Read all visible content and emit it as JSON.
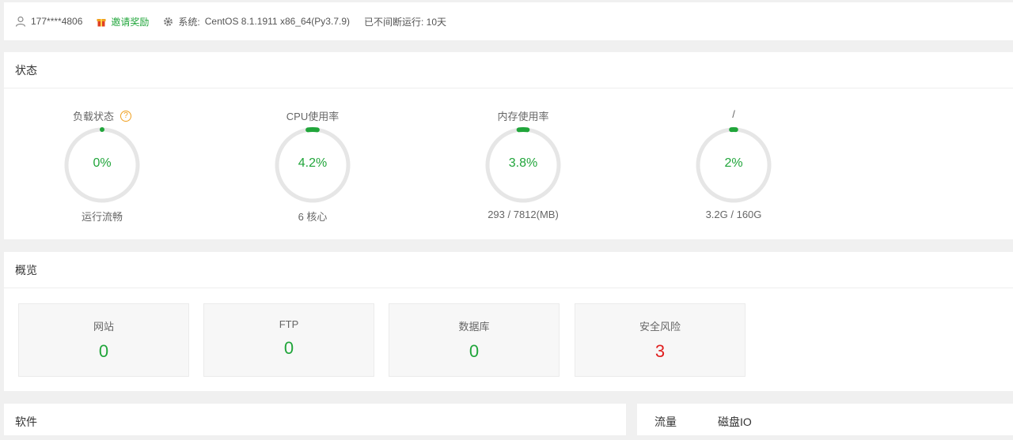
{
  "topbar": {
    "user": "177****4806",
    "invite": "邀请奖励",
    "system_label": "系统:",
    "system_value": "CentOS 8.1.1911 x86_64(Py3.7.9)",
    "uptime": "已不间断运行: 10天"
  },
  "status": {
    "title": "状态",
    "gauges": [
      {
        "title": "负载状态",
        "value": "0%",
        "percent": 0,
        "sub": "运行流畅",
        "help": "?"
      },
      {
        "title": "CPU使用率",
        "value": "4.2%",
        "percent": 4.2,
        "sub": "6 核心"
      },
      {
        "title": "内存使用率",
        "value": "3.8%",
        "percent": 3.8,
        "sub": "293 / 7812(MB)"
      },
      {
        "title": "/",
        "value": "2%",
        "percent": 2,
        "sub": "3.2G / 160G"
      }
    ]
  },
  "overview": {
    "title": "概览",
    "cards": [
      {
        "label": "网站",
        "value": "0"
      },
      {
        "label": "FTP",
        "value": "0"
      },
      {
        "label": "数据库",
        "value": "0"
      },
      {
        "label": "安全风险",
        "value": "3"
      }
    ]
  },
  "software": {
    "title": "软件"
  },
  "traffic": {
    "tabs": [
      "流量",
      "磁盘IO"
    ]
  },
  "colors": {
    "accent": "#20a53a",
    "danger": "#e02020",
    "ring_track": "#e6e6e6"
  }
}
